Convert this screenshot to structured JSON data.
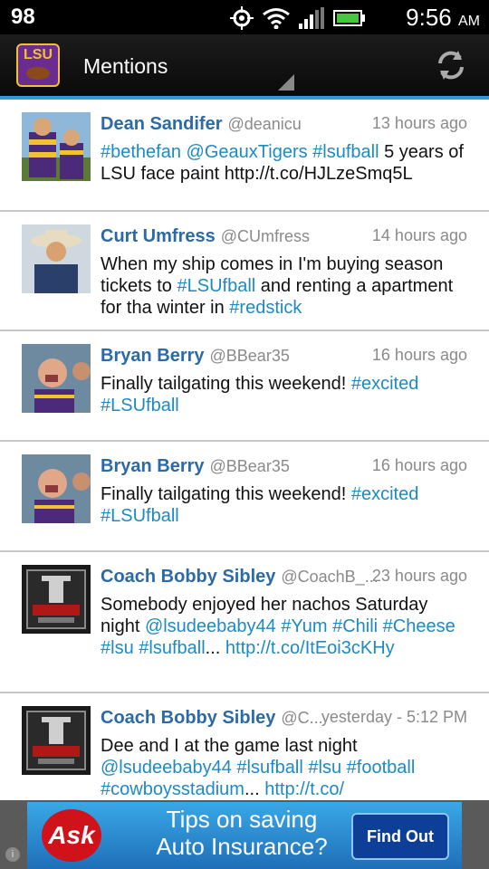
{
  "status_bar": {
    "battery_level": "98",
    "time": "9:56",
    "ampm": "AM"
  },
  "app_bar": {
    "logo_text": "LSU",
    "title": "Mentions"
  },
  "tweets": [
    {
      "name": "Dean Sandifer",
      "handle": "@deanicu",
      "time": "13 hours ago",
      "text_parts": [
        {
          "t": "#bethefan",
          "link": true
        },
        {
          "t": " ",
          "link": false
        },
        {
          "t": "@GeauxTigers",
          "link": true
        },
        {
          "t": " ",
          "link": false
        },
        {
          "t": "#lsufball",
          "link": true
        },
        {
          "t": " 5 years of LSU face paint http://t.co/HJLzeSmq5L",
          "link": false
        }
      ]
    },
    {
      "name": "Curt Umfress",
      "handle": "@CUmfress",
      "time": "14 hours ago",
      "text_parts": [
        {
          "t": "When my ship comes in I'm buying season tickets to ",
          "link": false
        },
        {
          "t": "#LSUfball",
          "link": true
        },
        {
          "t": " and renting a apartment for tha winter in ",
          "link": false
        },
        {
          "t": "#redstick",
          "link": true
        }
      ]
    },
    {
      "name": "Bryan Berry",
      "handle": "@BBear35",
      "time": "16 hours ago",
      "text_parts": [
        {
          "t": "Finally tailgating this weekend! ",
          "link": false
        },
        {
          "t": "#excited",
          "link": true
        },
        {
          "t": " ",
          "link": false
        },
        {
          "t": "#LSUfball",
          "link": true
        }
      ]
    },
    {
      "name": "Bryan Berry",
      "handle": "@BBear35",
      "time": "16 hours ago",
      "text_parts": [
        {
          "t": "Finally tailgating this weekend! ",
          "link": false
        },
        {
          "t": "#excited",
          "link": true
        },
        {
          "t": " ",
          "link": false
        },
        {
          "t": "#LSUfball",
          "link": true
        }
      ]
    },
    {
      "name": "Coach Bobby Sibley",
      "handle": "@CoachB_...",
      "time": "23 hours ago",
      "text_parts": [
        {
          "t": "Somebody enjoyed her nachos Saturday night ",
          "link": false
        },
        {
          "t": "@lsudeebaby44",
          "link": true
        },
        {
          "t": " ",
          "link": false
        },
        {
          "t": "#Yum",
          "link": true
        },
        {
          "t": " ",
          "link": false
        },
        {
          "t": "#Chili",
          "link": true
        },
        {
          "t": " ",
          "link": false
        },
        {
          "t": "#Cheese",
          "link": true
        },
        {
          "t": " ",
          "link": false
        },
        {
          "t": "#lsu",
          "link": true
        },
        {
          "t": " ",
          "link": false
        },
        {
          "t": "#lsufball",
          "link": true
        },
        {
          "t": "... ",
          "link": false
        },
        {
          "t": "http://t.co/ItEoi3cKHy",
          "link": true
        }
      ]
    },
    {
      "name": "Coach Bobby Sibley",
      "handle": "@C...",
      "time": "yesterday - 5:12 PM",
      "text_parts": [
        {
          "t": "Dee and I at the game last night ",
          "link": false
        },
        {
          "t": "@lsudeebaby44",
          "link": true
        },
        {
          "t": " ",
          "link": false
        },
        {
          "t": "#lsufball",
          "link": true
        },
        {
          "t": " ",
          "link": false
        },
        {
          "t": "#lsu",
          "link": true
        },
        {
          "t": " ",
          "link": false
        },
        {
          "t": "#football",
          "link": true
        },
        {
          "t": " ",
          "link": false
        },
        {
          "t": "#cowboysstadium",
          "link": true
        },
        {
          "t": "... ",
          "link": false
        },
        {
          "t": "http://t.co/",
          "link": true
        }
      ]
    }
  ],
  "ad": {
    "brand": "Ask",
    "headline_line1": "Tips on saving",
    "headline_line2": "Auto Insurance?",
    "cta": "Find Out",
    "info_glyph": "i"
  }
}
